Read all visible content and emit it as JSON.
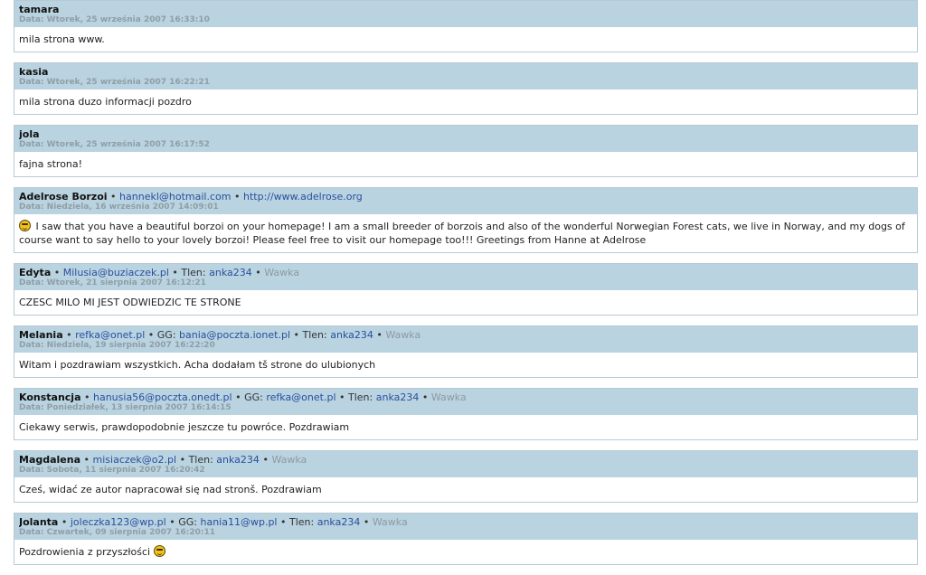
{
  "labels": {
    "date_prefix": "Data:",
    "separator": "•",
    "gg": "GG:",
    "tlen": "Tlen:"
  },
  "entries": [
    {
      "author": "tamara",
      "date": "Wtorek, 25 września 2007 16:33:10",
      "text": "mila strona www."
    },
    {
      "author": "kasia",
      "date": "Wtorek, 25 września 2007 16:22:21",
      "text": "mila strona duzo informacji pozdro"
    },
    {
      "author": "jola",
      "date": "Wtorek, 25 września 2007 16:17:52",
      "text": "fajna strona!"
    },
    {
      "author": "Adelrose Borzoi",
      "email": "hannekl@hotmail.com",
      "www": "http://www.adelrose.org",
      "date": "Niedziela, 16 września 2007 14:09:01",
      "smiley_before": true,
      "smiley_icon": "smiley-icon",
      "text": "I saw that you have a beautiful borzoi on your homepage! I am a small breeder of borzois and also of the wonderful Norwegian Forest cats, we live in Norway, and my dogs of course want to say hello to your lovely borzoi! Please feel free to visit our homepage too!!! Greetings from Hanne at Adelrose"
    },
    {
      "author": "Edyta",
      "email": "Milusia@buziaczek.pl",
      "tlen": "anka234",
      "city": "Wawka",
      "date": "Wtorek, 21 sierpnia 2007 16:12:21",
      "text": "CZESC MILO MI JEST ODWIEDZIC TE STRONE"
    },
    {
      "author": "Melania",
      "email": "refka@onet.pl",
      "gg": "bania@poczta.ionet.pl",
      "tlen": "anka234",
      "city": "Wawka",
      "date": "Niedziela, 19 sierpnia 2007 16:22:20",
      "text": "Witam i pozdrawiam wszystkich. Acha dodałam tš strone do ulubionych"
    },
    {
      "author": "Konstancja",
      "email": "hanusia56@poczta.onedt.pl",
      "gg": "refka@onet.pl",
      "tlen": "anka234",
      "city": "Wawka",
      "date": "Poniedziałek, 13 sierpnia 2007 16:14:15",
      "text": "Ciekawy serwis, prawdopodobnie jeszcze tu powróce. Pozdrawiam"
    },
    {
      "author": "Magdalena",
      "email": "misiaczek@o2.pl",
      "tlen": "anka234",
      "city": "Wawka",
      "date": "Sobota, 11 sierpnia 2007 16:20:42",
      "text": "Cześ, widać ze autor napracował się nad stronš. Pozdrawiam"
    },
    {
      "author": "Jolanta",
      "email": "joleczka123@wp.pl",
      "gg": "hania11@wp.pl",
      "tlen": "anka234",
      "city": "Wawka",
      "date": "Czwartek, 09 sierpnia 2007 16:20:11",
      "text": "Pozdrowienia z przyszłości",
      "smiley_after": true,
      "smiley_icon": "smiley-icon"
    }
  ]
}
